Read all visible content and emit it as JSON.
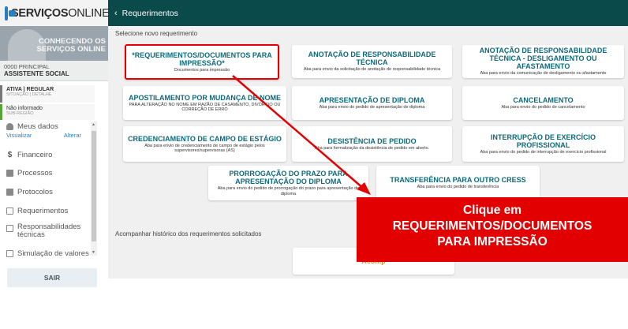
{
  "sidebar": {
    "logo_text_bold": "SERVIÇOS",
    "logo_text_rest": "ONLINE",
    "banner_line1": "CONHECENDO OS",
    "banner_line2": "SERVIÇOS ONLINE",
    "profile_line1": "0000  PRINCIPAL",
    "profile_line2": "ASSISTENTE SOCIAL",
    "status_line1": "ATIVA | REGULAR",
    "status_line2": "SITUAÇÃO | DETALHE",
    "subreg_line1": "Não informado",
    "subreg_line2": "SUB-REGIÃO",
    "menu": {
      "meus_dados": "Meus dados",
      "visualizar": "Visualizar",
      "alterar": "Alterar",
      "financeiro": "Financeiro",
      "processos": "Processos",
      "protocolos": "Protocolos",
      "requerimentos": "Requerimentos",
      "responsabilidades_l1": "Responsabilidades",
      "responsabilidades_l2": "técnicas",
      "simulacao": "Simulação de valores"
    },
    "sair_label": "SAIR"
  },
  "topbar": {
    "back_glyph": "‹",
    "title": "Requerimentos"
  },
  "main": {
    "select_label": "Selecione novo requerimento",
    "cards": [
      {
        "title": "*REQUERIMENTOS/DOCUMENTOS PARA IMPRESSÃO*",
        "desc": "Documentos para impressão"
      },
      {
        "title": "ANOTAÇÃO DE RESPONSABILIDADE TÉCNICA",
        "desc": "Aba para envio da solicitação de anotação de responsabilidade técnica"
      },
      {
        "title": "ANOTAÇÃO DE RESPONSABILIDADE TÉCNICA - DESLIGAMENTO OU AFASTAMENTO",
        "desc": "Aba para envio da comunicação de desligamento ou afastamento"
      },
      {
        "title": "APOSTILAMENTO POR MUDANÇA DE NOME",
        "desc": "PARA ALTERAÇÃO NO NOME EM RAZÃO DE CASAMENTO, DIVÓRCIO OU CORREÇÃO DE ERRO"
      },
      {
        "title": "APRESENTAÇÃO DE DIPLOMA",
        "desc": "Aba para envio do pedido de apresentação de diploma"
      },
      {
        "title": "CANCELAMENTO",
        "desc": "Aba para envio do pedido de cancelamento"
      },
      {
        "title": "CREDENCIAMENTO DE CAMPO DE ESTÁGIO",
        "desc": "Aba para envio de credenciamento de campo de estágio pelos supervisores/supervisoras (AS)"
      },
      {
        "title": "DESISTÊNCIA DE PEDIDO",
        "desc": "Aba para formalização da desistência de pedido em aberto."
      },
      {
        "title": "INTERRUPÇÃO DE EXERCÍCIO PROFISSIONAL",
        "desc": "Aba para envio do pedido de interrupção de exercício profissional"
      },
      {
        "title": "PRORROGAÇÃO DO PRAZO PARA APRESENTAÇÃO DO DIPLOMA",
        "desc": "Aba para envio do pedido de prorrogação do prazo para apresentação do diploma"
      },
      {
        "title": "TRANSFERÊNCIA PARA OUTRO CRESS",
        "desc": "Aba para envio do pedido de transferência"
      }
    ],
    "history_label": "Acompanhar histórico dos requerimentos solicitados",
    "history_button": "Acomp"
  },
  "callout": {
    "line1": "Clique em",
    "line2": "REQUERIMENTOS/DOCUMENTOS",
    "line3": "PARA IMPRESSÃO"
  },
  "colors": {
    "topbar": "#0b4a4a",
    "card_title": "#0c6a7a",
    "highlight": "#e40000",
    "callout": "#e20000"
  }
}
